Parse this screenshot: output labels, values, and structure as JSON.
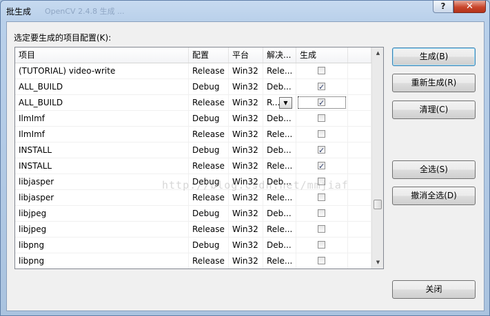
{
  "window": {
    "title": "批生成",
    "title_ghost": "OpenCV 2.4.8 生成 ...",
    "help_glyph": "?",
    "close_glyph": "✕"
  },
  "prompt": "选定要生成的项目配置(K):",
  "columns": [
    "项目",
    "配置",
    "平台",
    "解决...",
    "生成"
  ],
  "rows": [
    {
      "project": "(TUTORIAL) video-write",
      "config": "Release",
      "platform": "Win32",
      "solution": "Rele...",
      "build": false
    },
    {
      "project": "ALL_BUILD",
      "config": "Debug",
      "platform": "Win32",
      "solution": "Deb...",
      "build": true
    },
    {
      "project": "ALL_BUILD",
      "config": "Release",
      "platform": "Win32",
      "solution": "R...",
      "build": true
    },
    {
      "project": "IlmImf",
      "config": "Debug",
      "platform": "Win32",
      "solution": "Deb...",
      "build": false
    },
    {
      "project": "IlmImf",
      "config": "Release",
      "platform": "Win32",
      "solution": "Rele...",
      "build": false
    },
    {
      "project": "INSTALL",
      "config": "Debug",
      "platform": "Win32",
      "solution": "Deb...",
      "build": true
    },
    {
      "project": "INSTALL",
      "config": "Release",
      "platform": "Win32",
      "solution": "Rele...",
      "build": true
    },
    {
      "project": "libjasper",
      "config": "Debug",
      "platform": "Win32",
      "solution": "Deb...",
      "build": false
    },
    {
      "project": "libjasper",
      "config": "Release",
      "platform": "Win32",
      "solution": "Rele...",
      "build": false
    },
    {
      "project": "libjpeg",
      "config": "Debug",
      "platform": "Win32",
      "solution": "Deb...",
      "build": false
    },
    {
      "project": "libjpeg",
      "config": "Release",
      "platform": "Win32",
      "solution": "Rele...",
      "build": false
    },
    {
      "project": "libpng",
      "config": "Debug",
      "platform": "Win32",
      "solution": "Deb...",
      "build": false
    },
    {
      "project": "libpng",
      "config": "Release",
      "platform": "Win32",
      "solution": "Rele...",
      "build": false
    }
  ],
  "selected_row": 2,
  "watermark": "http://blog.csdn.net/mmjiaf",
  "buttons": {
    "build": "生成(B)",
    "rebuild": "重新生成(R)",
    "clean": "清理(C)",
    "select_all": "全选(S)",
    "deselect_all": "撤消全选(D)",
    "close": "关闭"
  },
  "icons": {
    "scroll_up": "▲",
    "scroll_down": "▼",
    "combo": "▼"
  }
}
